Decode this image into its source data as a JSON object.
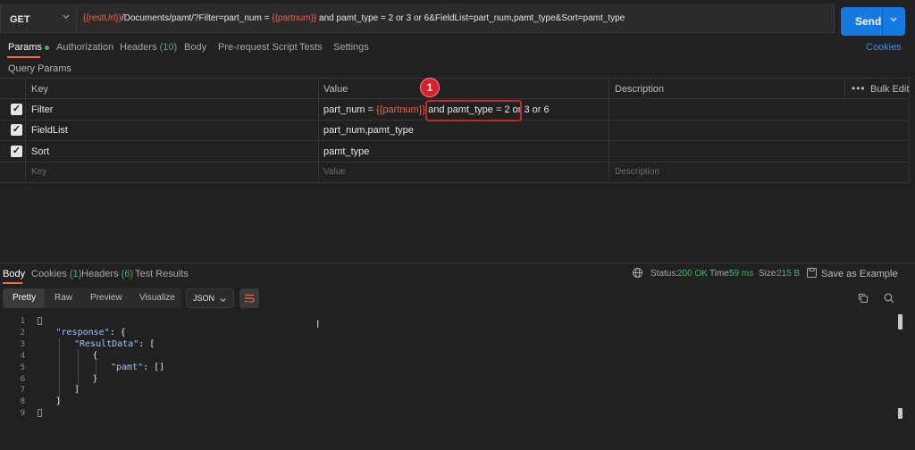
{
  "request": {
    "method": "GET",
    "url_parts": [
      {
        "text": "{{restUrl}}",
        "var": true
      },
      {
        "text": "/Documents/pamt/?Filter=part_num = ",
        "var": false
      },
      {
        "text": "{{partnum}}",
        "var": true
      },
      {
        "text": " and pamt_type = 2 or 3 or 6&FieldList=part_num,pamt_type&Sort=pamt_type",
        "var": false
      }
    ],
    "send_label": "Send"
  },
  "tabs": [
    {
      "label": "Params",
      "active": true,
      "dot": true
    },
    {
      "label": "Authorization"
    },
    {
      "label": "Headers",
      "count": "(10)"
    },
    {
      "label": "Body"
    },
    {
      "label": "Pre-request Script"
    },
    {
      "label": "Tests"
    },
    {
      "label": "Settings"
    }
  ],
  "cookies_link": "Cookies",
  "query_params_title": "Query Params",
  "table": {
    "headers": {
      "key": "Key",
      "value": "Value",
      "description": "Description",
      "bulk_edit": "Bulk Edit"
    },
    "rows": [
      {
        "key": "Filter",
        "value_parts": [
          {
            "text": "part_num = ",
            "var": false
          },
          {
            "text": "{{partnum}}",
            "var": true
          },
          {
            "text": " and pamt_type = 2 or 3 or 6",
            "var": false
          }
        ]
      },
      {
        "key": "FieldList",
        "value_parts": [
          {
            "text": "part_num,pamt_type",
            "var": false
          }
        ]
      },
      {
        "key": "Sort",
        "value_parts": [
          {
            "text": "pamt_type",
            "var": false
          }
        ]
      }
    ],
    "placeholders": {
      "key": "Key",
      "value": "Value",
      "description": "Description"
    }
  },
  "annotation_badge": "1",
  "response_tabs": [
    {
      "label": "Body",
      "active": true
    },
    {
      "label": "Cookies",
      "count": "(1)"
    },
    {
      "label": "Headers",
      "count": "(6)"
    },
    {
      "label": "Test Results"
    }
  ],
  "response_status": {
    "status_label": "Status:",
    "status_value": "200 OK",
    "time_label": "Time:",
    "time_value": "59 ms",
    "size_label": "Size:",
    "size_value": "215 B",
    "save_label": "Save as Example"
  },
  "view_modes": [
    "Pretty",
    "Raw",
    "Preview",
    "Visualize"
  ],
  "format": "JSON",
  "code_lines": [
    {
      "n": "1",
      "text": "{"
    },
    {
      "n": "2",
      "text": "\"response\": {"
    },
    {
      "n": "3",
      "text": "\"ResultData\": ["
    },
    {
      "n": "4",
      "text": "{"
    },
    {
      "n": "5",
      "text": "\"pamt\": []"
    },
    {
      "n": "6",
      "text": "}"
    },
    {
      "n": "7",
      "text": "]"
    },
    {
      "n": "8",
      "text": "}"
    },
    {
      "n": "9",
      "text": "}"
    }
  ],
  "colors": {
    "accent": "#f26b3a",
    "send": "#1479e0",
    "ok": "#4caf6a",
    "var": "#e7694a",
    "annotation": "#d62128"
  }
}
